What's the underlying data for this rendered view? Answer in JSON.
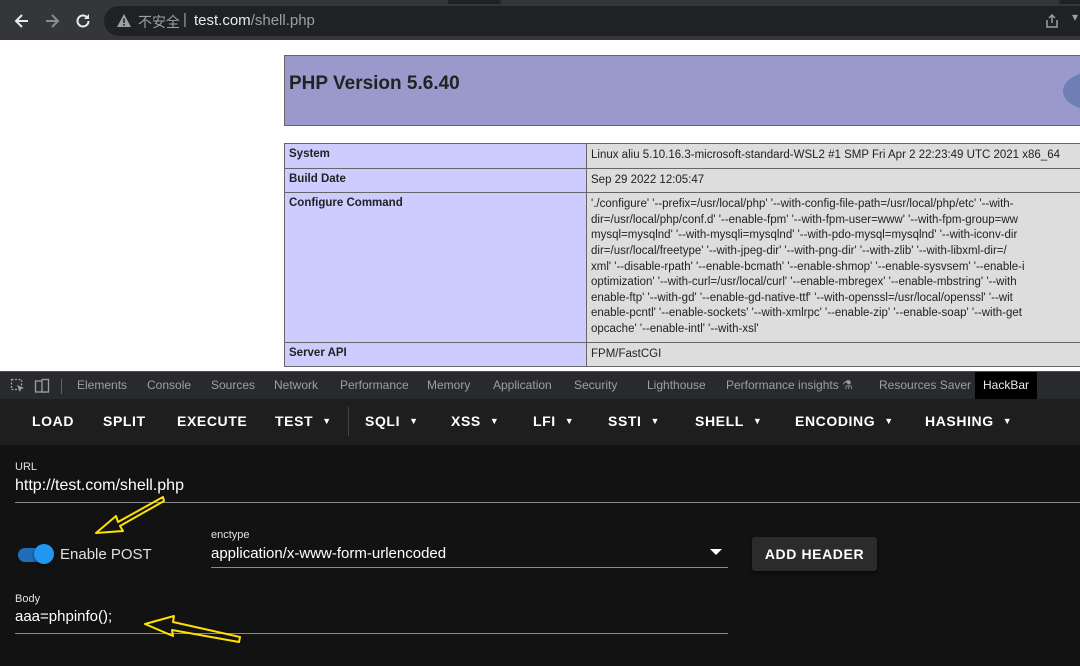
{
  "browser": {
    "insecure_label": "不安全",
    "separator": "|",
    "url_host": "test.com",
    "url_path": "/shell.php"
  },
  "page": {
    "php_version_title": "PHP Version 5.6.40",
    "rows": [
      {
        "key": "System",
        "value": "Linux aliu 5.10.16.3-microsoft-standard-WSL2 #1 SMP Fri Apr 2 22:23:49 UTC 2021 x86_64"
      },
      {
        "key": "Build Date",
        "value": "Sep 29 2022 12:05:47"
      },
      {
        "key": "Configure Command",
        "value": "'./configure' '--prefix=/usr/local/php' '--with-config-file-path=/usr/local/php/etc' '--with-\ndir=/usr/local/php/conf.d' '--enable-fpm' '--with-fpm-user=www' '--with-fpm-group=ww\nmysql=mysqlnd' '--with-mysqli=mysqlnd' '--with-pdo-mysql=mysqlnd' '--with-iconv-dir\ndir=/usr/local/freetype' '--with-jpeg-dir' '--with-png-dir' '--with-zlib' '--with-libxml-dir=/\nxml' '--disable-rpath' '--enable-bcmath' '--enable-shmop' '--enable-sysvsem' '--enable-i\noptimization' '--with-curl=/usr/local/curl' '--enable-mbregex' '--enable-mbstring' '--with\nenable-ftp' '--with-gd' '--enable-gd-native-ttf' '--with-openssl=/usr/local/openssl' '--wit\nenable-pcntl' '--enable-sockets' '--with-xmlrpc' '--enable-zip' '--enable-soap' '--with-get\nopcache' '--enable-intl' '--with-xsl'"
      },
      {
        "key": "Server API",
        "value": "FPM/FastCGI"
      }
    ]
  },
  "devtools": {
    "tabs": [
      "Elements",
      "Console",
      "Sources",
      "Network",
      "Performance",
      "Memory",
      "Application",
      "Security",
      "Lighthouse",
      "Performance insights",
      "Resources Saver",
      "HackBar"
    ],
    "active_tab": "HackBar"
  },
  "hackbar": {
    "toolbar": [
      "LOAD",
      "SPLIT",
      "EXECUTE",
      "TEST",
      "SQLI",
      "XSS",
      "LFI",
      "SSTI",
      "SHELL",
      "ENCODING",
      "HASHING"
    ],
    "url_label": "URL",
    "url_value": "http://test.com/shell.php",
    "enable_post_label": "Enable POST",
    "enable_post_on": true,
    "enctype_label": "enctype",
    "enctype_value": "application/x-www-form-urlencoded",
    "add_header_label": "ADD HEADER",
    "body_label": "Body",
    "body_value": "aaa=phpinfo();"
  },
  "colors": {
    "php_header": "#9999cc",
    "php_key_cell": "#ccccff",
    "php_value_cell": "#dddddd",
    "toggle_accent": "#2196f3",
    "annotation_arrow": "#ffe100"
  }
}
